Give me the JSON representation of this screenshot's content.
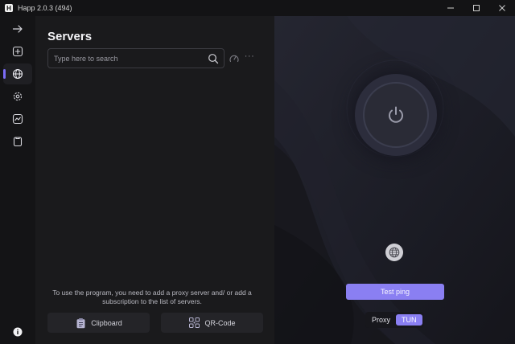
{
  "window": {
    "icon_letter": "H",
    "title": "Happ 2.0.3 (494)"
  },
  "sidebar": {
    "items": [
      {
        "name": "arrow-right-icon"
      },
      {
        "name": "add-square-icon"
      },
      {
        "name": "globe-icon",
        "active": true
      },
      {
        "name": "gear-icon"
      },
      {
        "name": "chart-icon"
      },
      {
        "name": "clipboard-icon"
      }
    ],
    "info_icon": "info-icon"
  },
  "servers": {
    "title": "Servers",
    "search_placeholder": "Type here to search",
    "empty_hint": "To use the program, you need to add a proxy server and/ or add a subscription to the list of servers.",
    "clipboard_label": "Clipboard",
    "qrcode_label": "QR-Code"
  },
  "connection": {
    "test_ping_label": "Test ping",
    "mode_options": [
      "Proxy",
      "TUN"
    ],
    "selected_mode": "TUN"
  },
  "colors": {
    "accent": "#8a7ff2",
    "background": "#1a1a1c"
  }
}
